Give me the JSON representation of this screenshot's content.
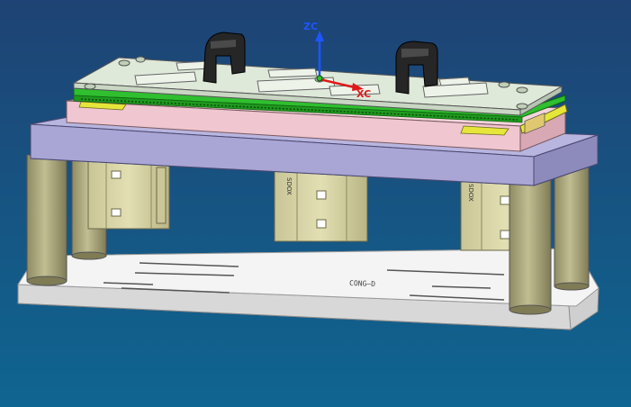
{
  "viewport": {
    "background_top": "#1e4374",
    "background_bottom": "#0f6591"
  },
  "axes": {
    "z_label": "ZC",
    "x_label": "XC",
    "z_color": "#1f55ff",
    "x_color": "#e01818"
  },
  "colors": {
    "top_plate": "#dfe9da",
    "green_layer": "#30c030",
    "pink_plate": "#f0c6d0",
    "purple_plate": "#a9a6d6",
    "posts": "#b1ac82",
    "cylinders": "#d6d2a4",
    "base_plate": "#eeeeee",
    "clamps": "#262626",
    "yellow_strip": "#e6e63a"
  },
  "labels": {
    "cylinder_mark": "SDOX",
    "base_mark": "CONG—D"
  }
}
